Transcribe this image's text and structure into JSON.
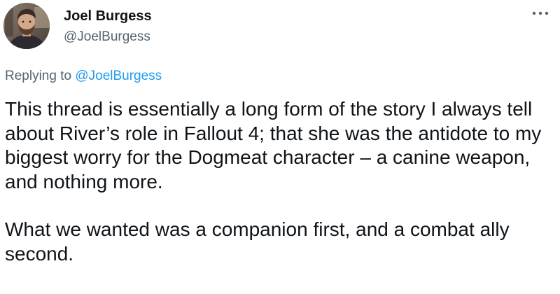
{
  "author": {
    "display_name": "Joel Burgess",
    "handle": "@JoelBurgess",
    "avatar_icon": "profile-photo"
  },
  "menu": {
    "icon": "more-horizontal-icon"
  },
  "reply": {
    "prefix": "Replying to ",
    "mention": "@JoelBurgess"
  },
  "body": {
    "paragraphs": [
      "This thread is essentially a long form of the story I always tell about River’s role in Fallout 4; that she was the antidote to my biggest worry for the Dogmeat character – a canine weapon, and nothing more.",
      "What we wanted was a companion first, and a combat ally second."
    ]
  },
  "colors": {
    "text": "#0f1419",
    "secondary": "#536471",
    "link": "#1d9bf0"
  }
}
